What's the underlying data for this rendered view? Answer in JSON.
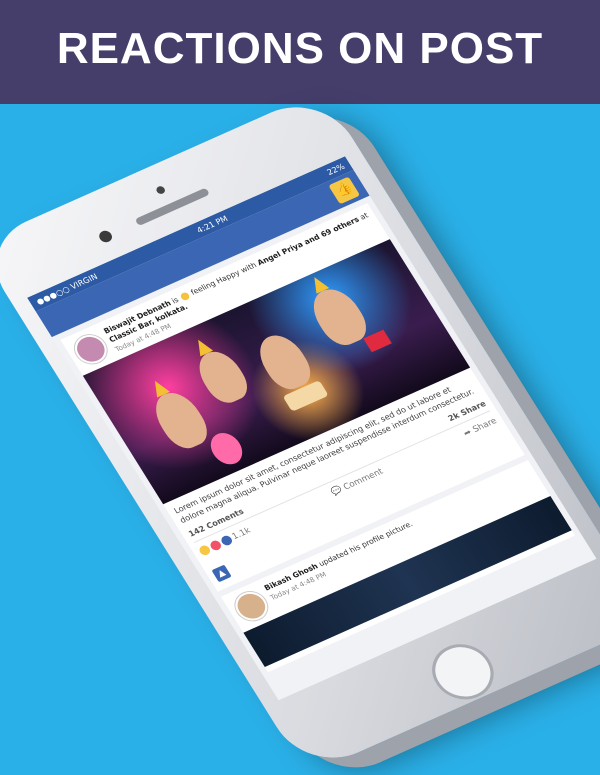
{
  "banner": {
    "title": "REACTIONS ON POST"
  },
  "status_bar": {
    "carrier": "●●●○○ VIRGIN",
    "time": "4:21 PM",
    "battery": "22%"
  },
  "post1": {
    "author": "Biswajit Debnath",
    "text_is": "is",
    "feeling": "feeling Happy",
    "with_text": "with",
    "tagged": "Angel Priya and 69 others",
    "at_text": "at",
    "place": "Classic Bar, kolkata.",
    "time": "Today at 4:48 PM",
    "body": "Lorem ipsum dolor sit amet, consectetur adipiscing elit, sed do ut labore et dolore magna aliqua. Pulvinar neque laoreet suspendisse interdum consectetur.",
    "comments": "142 Coments",
    "shares": "2k Share",
    "reaction_count": "1.1k",
    "comment_label": "Comment",
    "share_label": "Share"
  },
  "post2": {
    "author": "Bikash Ghosh",
    "action": "updated his profile picture.",
    "time": "Today at 4:48 PM"
  },
  "icons": {
    "nav_like": "thumbs-up-icon",
    "reactions": [
      "haha-icon",
      "love-icon",
      "like-icon"
    ],
    "comment": "comment-icon",
    "share": "share-icon"
  },
  "colors": {
    "banner_bg": "#453e6b",
    "background": "#2ab0e8",
    "facebook_blue": "#3b66b3"
  }
}
